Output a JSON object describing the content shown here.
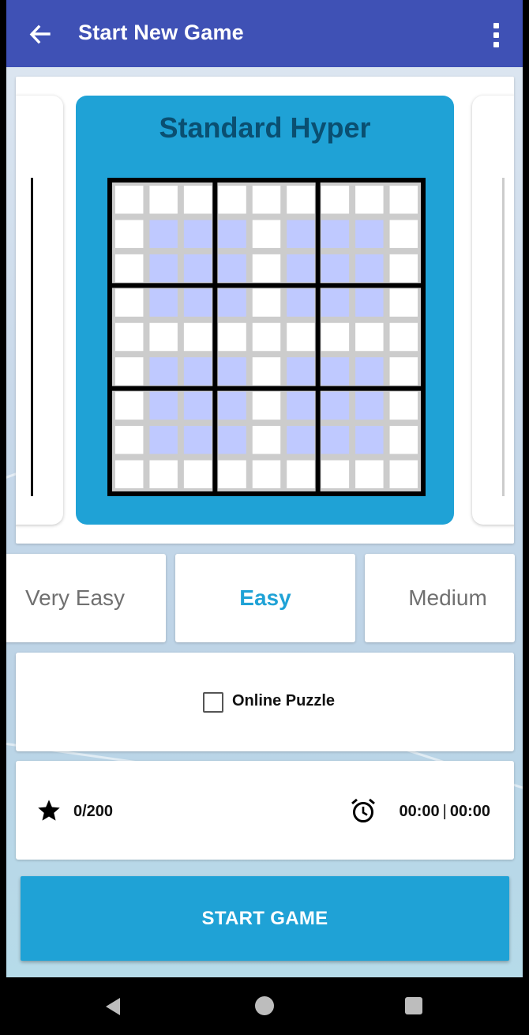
{
  "app_bar": {
    "title": "Start New Game",
    "color": "#3f51b5"
  },
  "carousel": {
    "current_puzzle": "Standard Hyper",
    "card_color": "#1fa2d6",
    "title_color": "#0a4f71",
    "preview": {
      "size": 9,
      "hyper_highlight_color": "#bfc9ff",
      "cell_gap_color": "#cccccc",
      "hyper_regions": [
        [
          1,
          1
        ],
        [
          1,
          5
        ],
        [
          5,
          1
        ],
        [
          5,
          5
        ]
      ]
    }
  },
  "difficulty": {
    "options": [
      "Very Easy",
      "Easy",
      "Medium"
    ],
    "selected": "Easy",
    "selected_color": "#1fa2d6"
  },
  "online": {
    "label": "Online Puzzle",
    "checked": false
  },
  "stats": {
    "score": "0/200",
    "time_best": "00:00",
    "time_separator": "|",
    "time_avg": "00:00"
  },
  "start_button": {
    "label": "START GAME",
    "color": "#1fa2d6"
  },
  "icons": {
    "back": "arrow-back-icon",
    "menu": "more-vert-icon",
    "star": "star-icon",
    "alarm": "alarm-icon"
  }
}
